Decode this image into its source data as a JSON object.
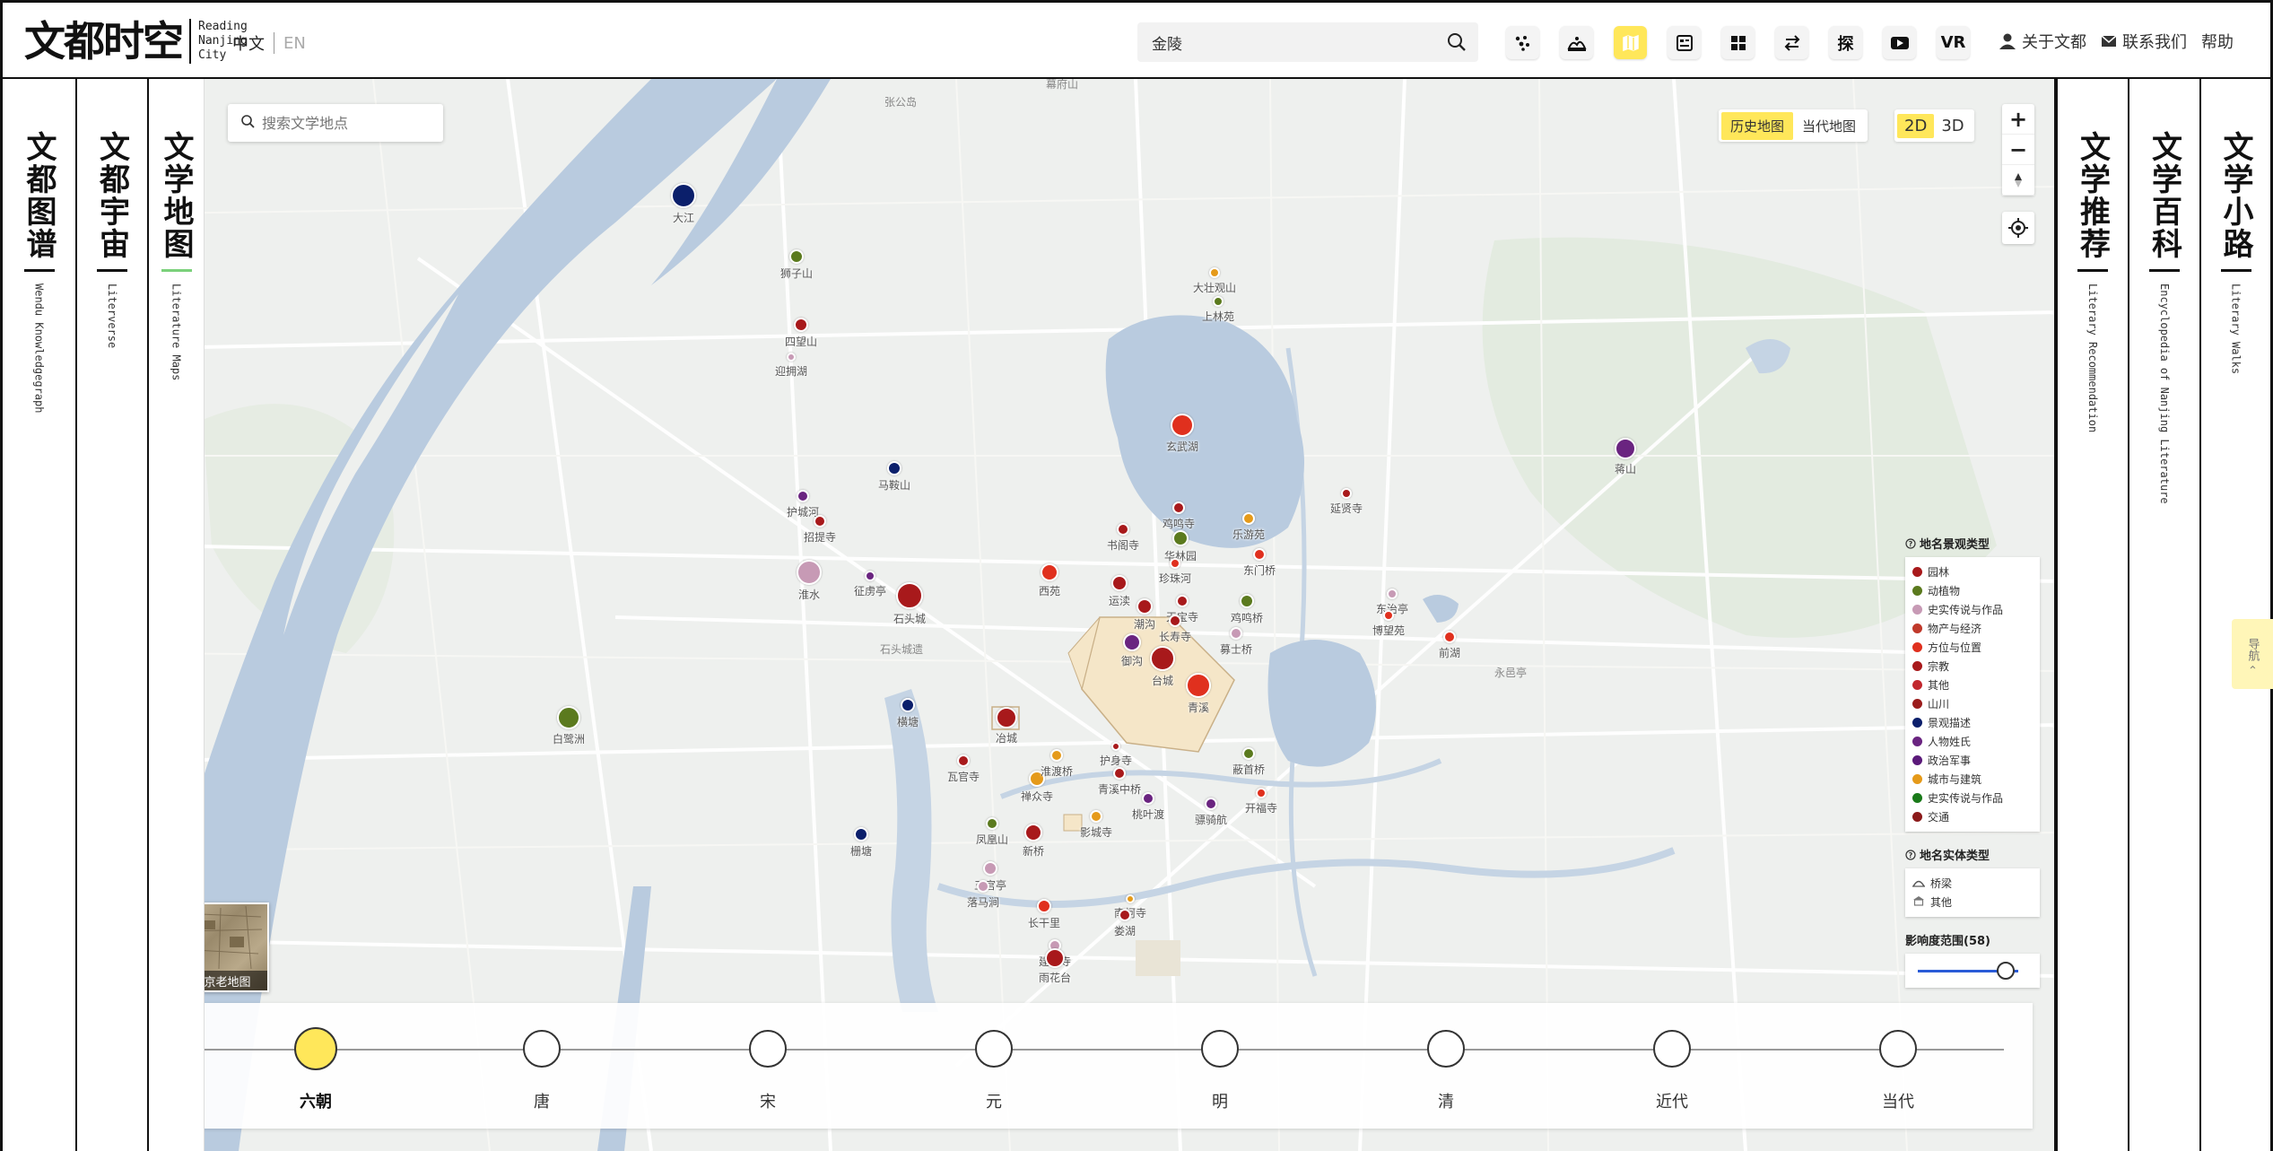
{
  "header": {
    "logo_cn": "文都时空",
    "logo_en": [
      "Reading",
      "Nanjing",
      "City"
    ],
    "lang_cn": "中文",
    "lang_en": "EN",
    "search_value": "金陵",
    "explore_label": "探",
    "vr_label": "VR",
    "about": "关于文都",
    "contact": "联系我们",
    "help": "帮助"
  },
  "left_columns": [
    {
      "cn": "文都图谱",
      "en": "Wendu Knowledgegraph"
    },
    {
      "cn": "文都宇宙",
      "en": "Literverse"
    },
    {
      "cn": "文学地图",
      "en": "Literature Maps"
    }
  ],
  "right_columns": [
    {
      "cn": "文学推荐",
      "en": "Literary Recommendation"
    },
    {
      "cn": "文学百科",
      "en": "Encyclopedia of Nanjing Literature"
    },
    {
      "cn": "文学小路",
      "en": "Literary Walks"
    }
  ],
  "map": {
    "search_placeholder": "搜索文学地点",
    "map_types": [
      "历史地图",
      "当代地图"
    ],
    "dims": [
      "2D",
      "3D"
    ],
    "old_map_label": "南京老地图",
    "nav_tab": "导航 ‹",
    "base_labels": [
      "张公岛",
      "幕府山",
      "石头城遗",
      "永邑亭"
    ],
    "markers": [
      {
        "label": "大江",
        "color": "#0b1f6b"
      },
      {
        "label": "狮子山",
        "color": "#5b7a1e"
      },
      {
        "label": "四望山",
        "color": "#a8191b"
      },
      {
        "label": "迎拥湖",
        "color": "#c79ab5"
      },
      {
        "label": "大壮观山",
        "color": "#e59a1a"
      },
      {
        "label": "上林苑",
        "color": "#5b7a1e"
      },
      {
        "label": "玄武湖",
        "color": "#e0301e"
      },
      {
        "label": "蒋山",
        "color": "#6a2480"
      },
      {
        "label": "马鞍山",
        "color": "#0b1f6b"
      },
      {
        "label": "护城河",
        "color": "#6a2480"
      },
      {
        "label": "招提寺",
        "color": "#a8191b"
      },
      {
        "label": "淮水",
        "color": "#c79ab5"
      },
      {
        "label": "征虏亭",
        "color": "#6a2480"
      },
      {
        "label": "石头城",
        "color": "#a8191b"
      },
      {
        "label": "西苑",
        "color": "#e0301e"
      },
      {
        "label": "鸡鸣寺",
        "color": "#a8191b"
      },
      {
        "label": "书阁寺",
        "color": "#a8191b"
      },
      {
        "label": "华林园",
        "color": "#5b7a1e"
      },
      {
        "label": "珍珠河",
        "color": "#e0301e"
      },
      {
        "label": "乐游苑",
        "color": "#e59a1a"
      },
      {
        "label": "东门桥",
        "color": "#e0301e"
      },
      {
        "label": "延贤寺",
        "color": "#a8191b"
      },
      {
        "label": "运渎",
        "color": "#a8191b"
      },
      {
        "label": "潮沟",
        "color": "#a8191b"
      },
      {
        "label": "天宝寺",
        "color": "#a8191b"
      },
      {
        "label": "鸡鸣桥",
        "color": "#5b7a1e"
      },
      {
        "label": "长寿寺",
        "color": "#a8191b"
      },
      {
        "label": "御沟",
        "color": "#6a2480"
      },
      {
        "label": "台城",
        "color": "#a8191b"
      },
      {
        "label": "东治亭",
        "color": "#c79ab5"
      },
      {
        "label": "博望苑",
        "color": "#e0301e"
      },
      {
        "label": "前湖",
        "color": "#e0301e"
      },
      {
        "label": "青溪",
        "color": "#e0301e"
      },
      {
        "label": "募士桥",
        "color": "#c79ab5"
      },
      {
        "label": "白鹭洲",
        "color": "#5b7a1e"
      },
      {
        "label": "横塘",
        "color": "#0b1f6b"
      },
      {
        "label": "冶城",
        "color": "#a8191b"
      },
      {
        "label": "护身寺",
        "color": "#a8191b"
      },
      {
        "label": "瓦官寺",
        "color": "#a8191b"
      },
      {
        "label": "禅众寺",
        "color": "#e59a1a"
      },
      {
        "label": "淮渡桥",
        "color": "#e59a1a"
      },
      {
        "label": "青溪中桥",
        "color": "#a8191b"
      },
      {
        "label": "蔽首桥",
        "color": "#5b7a1e"
      },
      {
        "label": "开福寺",
        "color": "#e0301e"
      },
      {
        "label": "桃叶渡",
        "color": "#6a2480"
      },
      {
        "label": "骠骑航",
        "color": "#6a2480"
      },
      {
        "label": "影城寺",
        "color": "#e59a1a"
      },
      {
        "label": "凤凰山",
        "color": "#5b7a1e"
      },
      {
        "label": "新桥",
        "color": "#a8191b"
      },
      {
        "label": "五官亭",
        "color": "#c79ab5"
      },
      {
        "label": "栅塘",
        "color": "#0b1f6b"
      },
      {
        "label": "落马涧",
        "color": "#c79ab5"
      },
      {
        "label": "长干里",
        "color": "#e0301e"
      },
      {
        "label": "南柯寺",
        "color": "#e59a1a"
      },
      {
        "label": "娄湖",
        "color": "#a8191b"
      },
      {
        "label": "建初寺",
        "color": "#c79ab5"
      },
      {
        "label": "雨花台",
        "color": "#a8191b"
      }
    ]
  },
  "legend": {
    "landscape_title": "地名景观类型",
    "landscape_items": [
      {
        "label": "园林",
        "color": "#a8191b"
      },
      {
        "label": "动植物",
        "color": "#5b7a1e"
      },
      {
        "label": "史实传说与作品",
        "color": "#c79ab5"
      },
      {
        "label": "物产与经济",
        "color": "#c0392b"
      },
      {
        "label": "方位与位置",
        "color": "#e0301e"
      },
      {
        "label": "宗教",
        "color": "#a8191b"
      },
      {
        "label": "其他",
        "color": "#c1272d"
      },
      {
        "label": "山川",
        "color": "#9b1c1c"
      },
      {
        "label": "景观描述",
        "color": "#0b1f6b"
      },
      {
        "label": "人物姓氏",
        "color": "#6a2480"
      },
      {
        "label": "政治军事",
        "color": "#5b1a7a"
      },
      {
        "label": "城市与建筑",
        "color": "#e59a1a"
      },
      {
        "label": "史实传说与作品",
        "color": "#1a7a1a"
      },
      {
        "label": "交通",
        "color": "#8b1a1a"
      }
    ],
    "entity_title": "地名实体类型",
    "entity_items": [
      "桥梁",
      "其他"
    ],
    "influence_label": "影响度范围(58)",
    "influence_value": 0.93
  },
  "timeline": {
    "eras": [
      "六朝",
      "唐",
      "宋",
      "元",
      "明",
      "清",
      "近代",
      "当代"
    ],
    "selected": 0
  },
  "colors": {
    "accent": "#ffe75a",
    "water": "#b9cbdf",
    "land": "#eef0ee"
  }
}
